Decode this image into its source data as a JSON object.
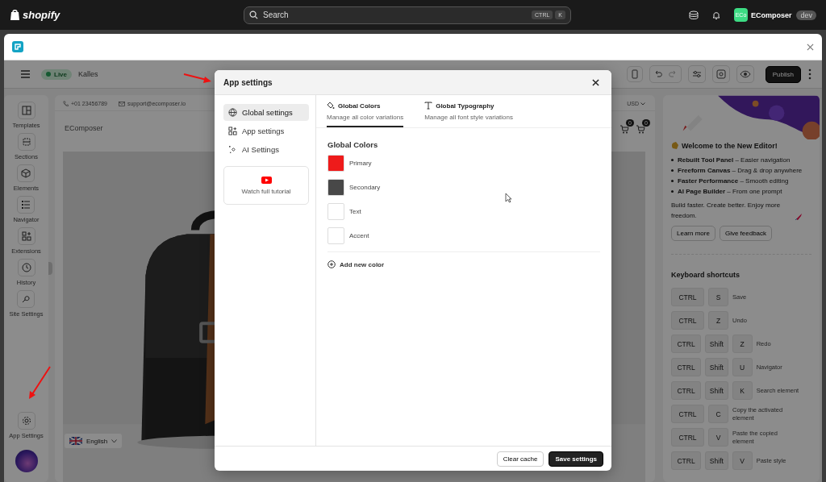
{
  "topbar": {
    "logo": "shopify",
    "search": {
      "placeholder": "Search",
      "keys": [
        "CTRL",
        "K"
      ]
    },
    "store": {
      "initials": "ECo",
      "name": "EComposer",
      "badge": "dev"
    }
  },
  "editor_bar": {
    "status": "Live",
    "store": "Kalles",
    "publish": "Publish"
  },
  "sidebar": {
    "items": [
      {
        "label": "Templates"
      },
      {
        "label": "Sections"
      },
      {
        "label": "Elements"
      },
      {
        "label": "Navigator"
      },
      {
        "label": "Extensions"
      },
      {
        "label": "History"
      },
      {
        "label": "Site Settings"
      }
    ],
    "footer": "App Settings"
  },
  "canvas": {
    "phone": "+01 23456789",
    "email": "support@ecomposer.io",
    "brand": "EComposer",
    "currency": "USD",
    "cart_counts": [
      "0",
      "0"
    ],
    "language": "English"
  },
  "dialog": {
    "title": "App settings",
    "nav": [
      {
        "label": "Global settings",
        "selected": true
      },
      {
        "label": "App settings",
        "selected": false
      },
      {
        "label": "AI Settings",
        "selected": false
      }
    ],
    "tutorial": "Watch full tutorial",
    "tabs": [
      {
        "title": "Global Colors",
        "subtitle": "Manage all color variations",
        "selected": true
      },
      {
        "title": "Global Typography",
        "subtitle": "Manage all font style variations",
        "selected": false
      }
    ],
    "section_title": "Global Colors",
    "colors": [
      {
        "name": "Primary",
        "color": "#ee1b1b"
      },
      {
        "name": "Secondary",
        "color": "#484848"
      },
      {
        "name": "Text",
        "color": "#ffffff"
      },
      {
        "name": "Accent",
        "color": "#ffffff"
      }
    ],
    "add_color": "Add new color",
    "buttons": {
      "secondary": "Clear cache",
      "primary": "Save settings"
    }
  },
  "panel": {
    "welcome": "Welcome to the New Editor!",
    "features": [
      "**Rebuilt Tool Panel** – Easier navigation",
      "**Freeform Canvas** – Drag & drop anywhere",
      "**Faster Performance** – Smooth editing",
      "**AI Page Builder** – From one prompt"
    ],
    "tagline": "Build faster. Create better. Enjoy more freedom.",
    "actions": [
      "Learn more",
      "Give feedback"
    ],
    "shortcuts_title": "Keyboard shortcuts",
    "shortcuts": [
      {
        "keys": [
          "CTRL",
          "S"
        ],
        "action": "Save"
      },
      {
        "keys": [
          "CTRL",
          "Z"
        ],
        "action": "Undo"
      },
      {
        "keys": [
          "CTRL",
          "Shift",
          "Z"
        ],
        "action": "Redo"
      },
      {
        "keys": [
          "CTRL",
          "Shift",
          "U"
        ],
        "action": "Navigator"
      },
      {
        "keys": [
          "CTRL",
          "Shift",
          "K"
        ],
        "action": "Search element"
      },
      {
        "keys": [
          "CTRL",
          "C"
        ],
        "action": "Copy the activated element"
      },
      {
        "keys": [
          "CTRL",
          "V"
        ],
        "action": "Paste the copied element"
      },
      {
        "keys": [
          "CTRL",
          "Shift",
          "V"
        ],
        "action": "Paste style"
      }
    ]
  }
}
